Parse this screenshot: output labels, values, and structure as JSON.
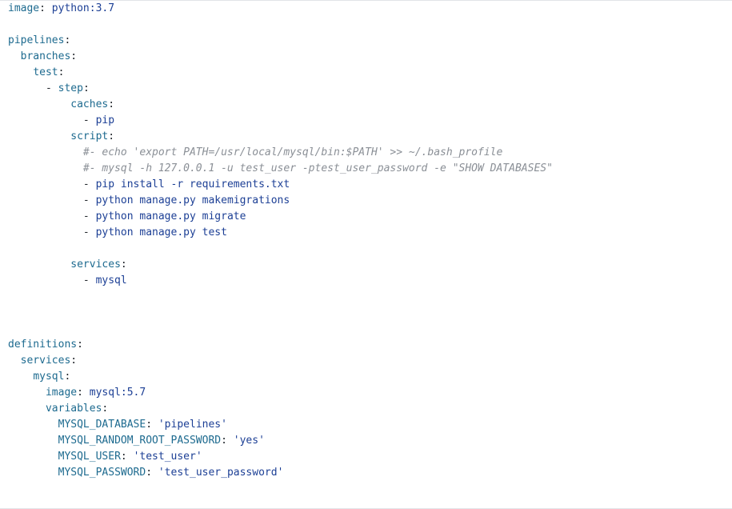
{
  "lines": [
    {
      "indent": "",
      "key": "image",
      "sep": ": ",
      "val": "python:3.7"
    },
    {
      "blank": true
    },
    {
      "indent": "",
      "key": "pipelines",
      "sep": ":"
    },
    {
      "indent": "  ",
      "key": "branches",
      "sep": ":"
    },
    {
      "indent": "    ",
      "key": "test",
      "sep": ":"
    },
    {
      "indent": "      ",
      "dash": "- ",
      "key": "step",
      "sep": ":"
    },
    {
      "indent": "          ",
      "key": "caches",
      "sep": ":"
    },
    {
      "indent": "            ",
      "dash": "- ",
      "val": "pip"
    },
    {
      "indent": "          ",
      "key": "script",
      "sep": ":"
    },
    {
      "indent": "            ",
      "comment": "#- echo 'export PATH=/usr/local/mysql/bin:$PATH' >> ~/.bash_profile"
    },
    {
      "indent": "            ",
      "comment": "#- mysql -h 127.0.0.1 -u test_user -ptest_user_password -e \"SHOW DATABASES\""
    },
    {
      "indent": "            ",
      "dash": "- ",
      "val": "pip install -r requirements.txt"
    },
    {
      "indent": "            ",
      "dash": "- ",
      "val": "python manage.py makemigrations"
    },
    {
      "indent": "            ",
      "dash": "- ",
      "val": "python manage.py migrate"
    },
    {
      "indent": "            ",
      "dash": "- ",
      "val": "python manage.py test"
    },
    {
      "blank": true
    },
    {
      "indent": "          ",
      "key": "services",
      "sep": ":"
    },
    {
      "indent": "            ",
      "dash": "- ",
      "val": "mysql"
    },
    {
      "blank": true
    },
    {
      "blank": true
    },
    {
      "blank": true
    },
    {
      "indent": "",
      "key": "definitions",
      "sep": ":"
    },
    {
      "indent": "  ",
      "key": "services",
      "sep": ":"
    },
    {
      "indent": "    ",
      "key": "mysql",
      "sep": ":"
    },
    {
      "indent": "      ",
      "key": "image",
      "sep": ": ",
      "val": "mysql:5.7"
    },
    {
      "indent": "      ",
      "key": "variables",
      "sep": ":"
    },
    {
      "indent": "        ",
      "key": "MYSQL_DATABASE",
      "sep": ": ",
      "val": "'pipelines'"
    },
    {
      "indent": "        ",
      "key": "MYSQL_RANDOM_ROOT_PASSWORD",
      "sep": ": ",
      "val": "'yes'"
    },
    {
      "indent": "        ",
      "key": "MYSQL_USER",
      "sep": ": ",
      "val": "'test_user'"
    },
    {
      "indent": "        ",
      "key": "MYSQL_PASSWORD",
      "sep": ": ",
      "val": "'test_user_password'"
    }
  ]
}
